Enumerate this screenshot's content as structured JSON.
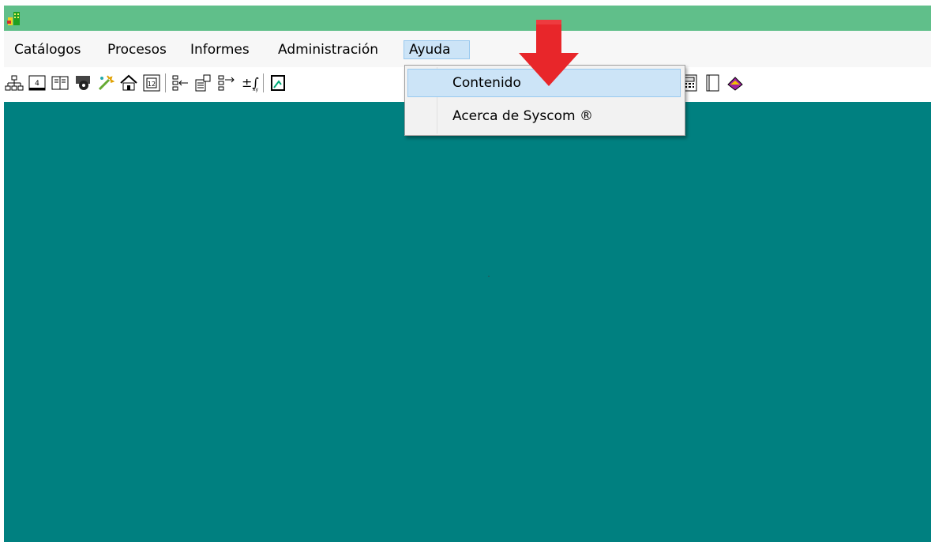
{
  "menubar": {
    "items": [
      {
        "label": "Catálogos"
      },
      {
        "label": "Procesos"
      },
      {
        "label": "Informes"
      },
      {
        "label": "Administración"
      },
      {
        "label": "Ayuda",
        "active": true
      }
    ]
  },
  "dropdown": {
    "items": [
      {
        "label": "Contenido",
        "hover": true
      },
      {
        "label": "Acerca de Syscom ®"
      }
    ]
  },
  "toolbar": {
    "icons": [
      "org-chart-icon",
      "calendar-icon",
      "book-icon",
      "gear-person-icon",
      "wand-icon",
      "home-icon",
      "date-12-icon",
      "tree-left-icon",
      "document-tree-icon",
      "tree-right-icon",
      "function-icon",
      "print-icon",
      "calculator-icon",
      "page-icon",
      "book-red-icon"
    ]
  },
  "colors": {
    "titlebar": "#60bf8a",
    "workspace": "#008080",
    "highlight": "#cce4f7",
    "arrow": "#e8262a"
  }
}
